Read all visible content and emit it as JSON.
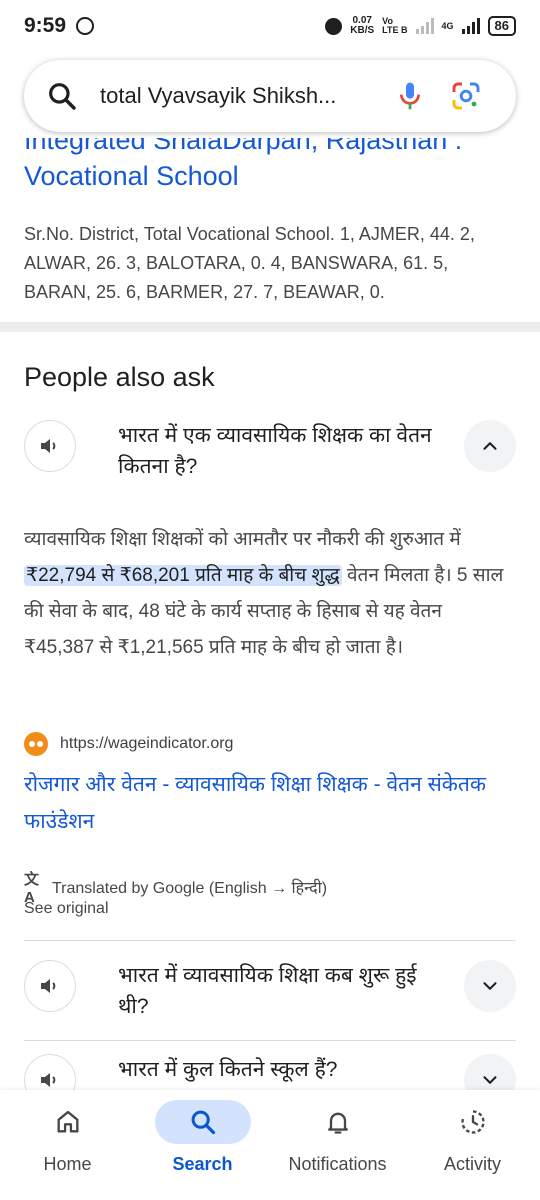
{
  "status_bar": {
    "time": "9:59",
    "speed_value": "0.07",
    "speed_unit": "KB/S",
    "volte_top": "Vo",
    "volte_bottom": "LTE B",
    "network": "4G",
    "battery": "86"
  },
  "search": {
    "query": "total Vyavsayik Shiksh...",
    "icon": "search-icon"
  },
  "top_result": {
    "title_clipped": "Integrated ShalaDarpan, Rajasthan :",
    "title_line2": "Vocational School",
    "snippet": "Sr.No. District, Total Vocational School. 1, AJMER, 44. 2, ALWAR, 26. 3, BALOTARA, 0. 4, BANSWARA, 61. 5, BARAN, 25. 6, BARMER, 27. 7, BEAWAR, 0."
  },
  "paa": {
    "heading": "People also ask",
    "questions": [
      {
        "text": "भारत में एक व्यावसायिक शिक्षक का वेतन कितना है?",
        "expanded": true
      },
      {
        "text": "भारत में व्यावसायिक शिक्षा कब शुरू हुई थी?",
        "expanded": false
      },
      {
        "text": "भारत में कुल कितने स्कूल हैं?",
        "expanded": false
      }
    ],
    "answer": {
      "before": "व्यावसायिक शिक्षा शिक्षकों को आमतौर पर नौकरी की शुरुआत में ",
      "highlight": "₹22,794 से ₹68,201 प्रति माह के बीच शुद्ध",
      "after": " वेतन मिलता है। 5 साल की सेवा के बाद, 48 घंटे के कार्य सप्ताह के हिसाब से यह वेतन ₹45,387 से ₹1,21,565 प्रति माह के बीच हो जाता है।"
    },
    "source_url": "https://wageindicator.org",
    "source_title": "रोजगार और वेतन - व्यावसायिक शिक्षा शिक्षक - वेतन संकेतक फाउंडेशन",
    "translated_note": "Translated by Google (English → हिन्दी)",
    "see_original": "See original"
  },
  "bottom_nav": {
    "items": [
      {
        "label": "Home",
        "icon": "home-icon",
        "active": false
      },
      {
        "label": "Search",
        "icon": "search-icon",
        "active": true
      },
      {
        "label": "Notifications",
        "icon": "bell-icon",
        "active": false
      },
      {
        "label": "Activity",
        "icon": "activity-icon",
        "active": false
      }
    ]
  },
  "colors": {
    "link": "#1558d6",
    "highlight": "#d3e3fd",
    "active_nav": "#0b57d0"
  }
}
